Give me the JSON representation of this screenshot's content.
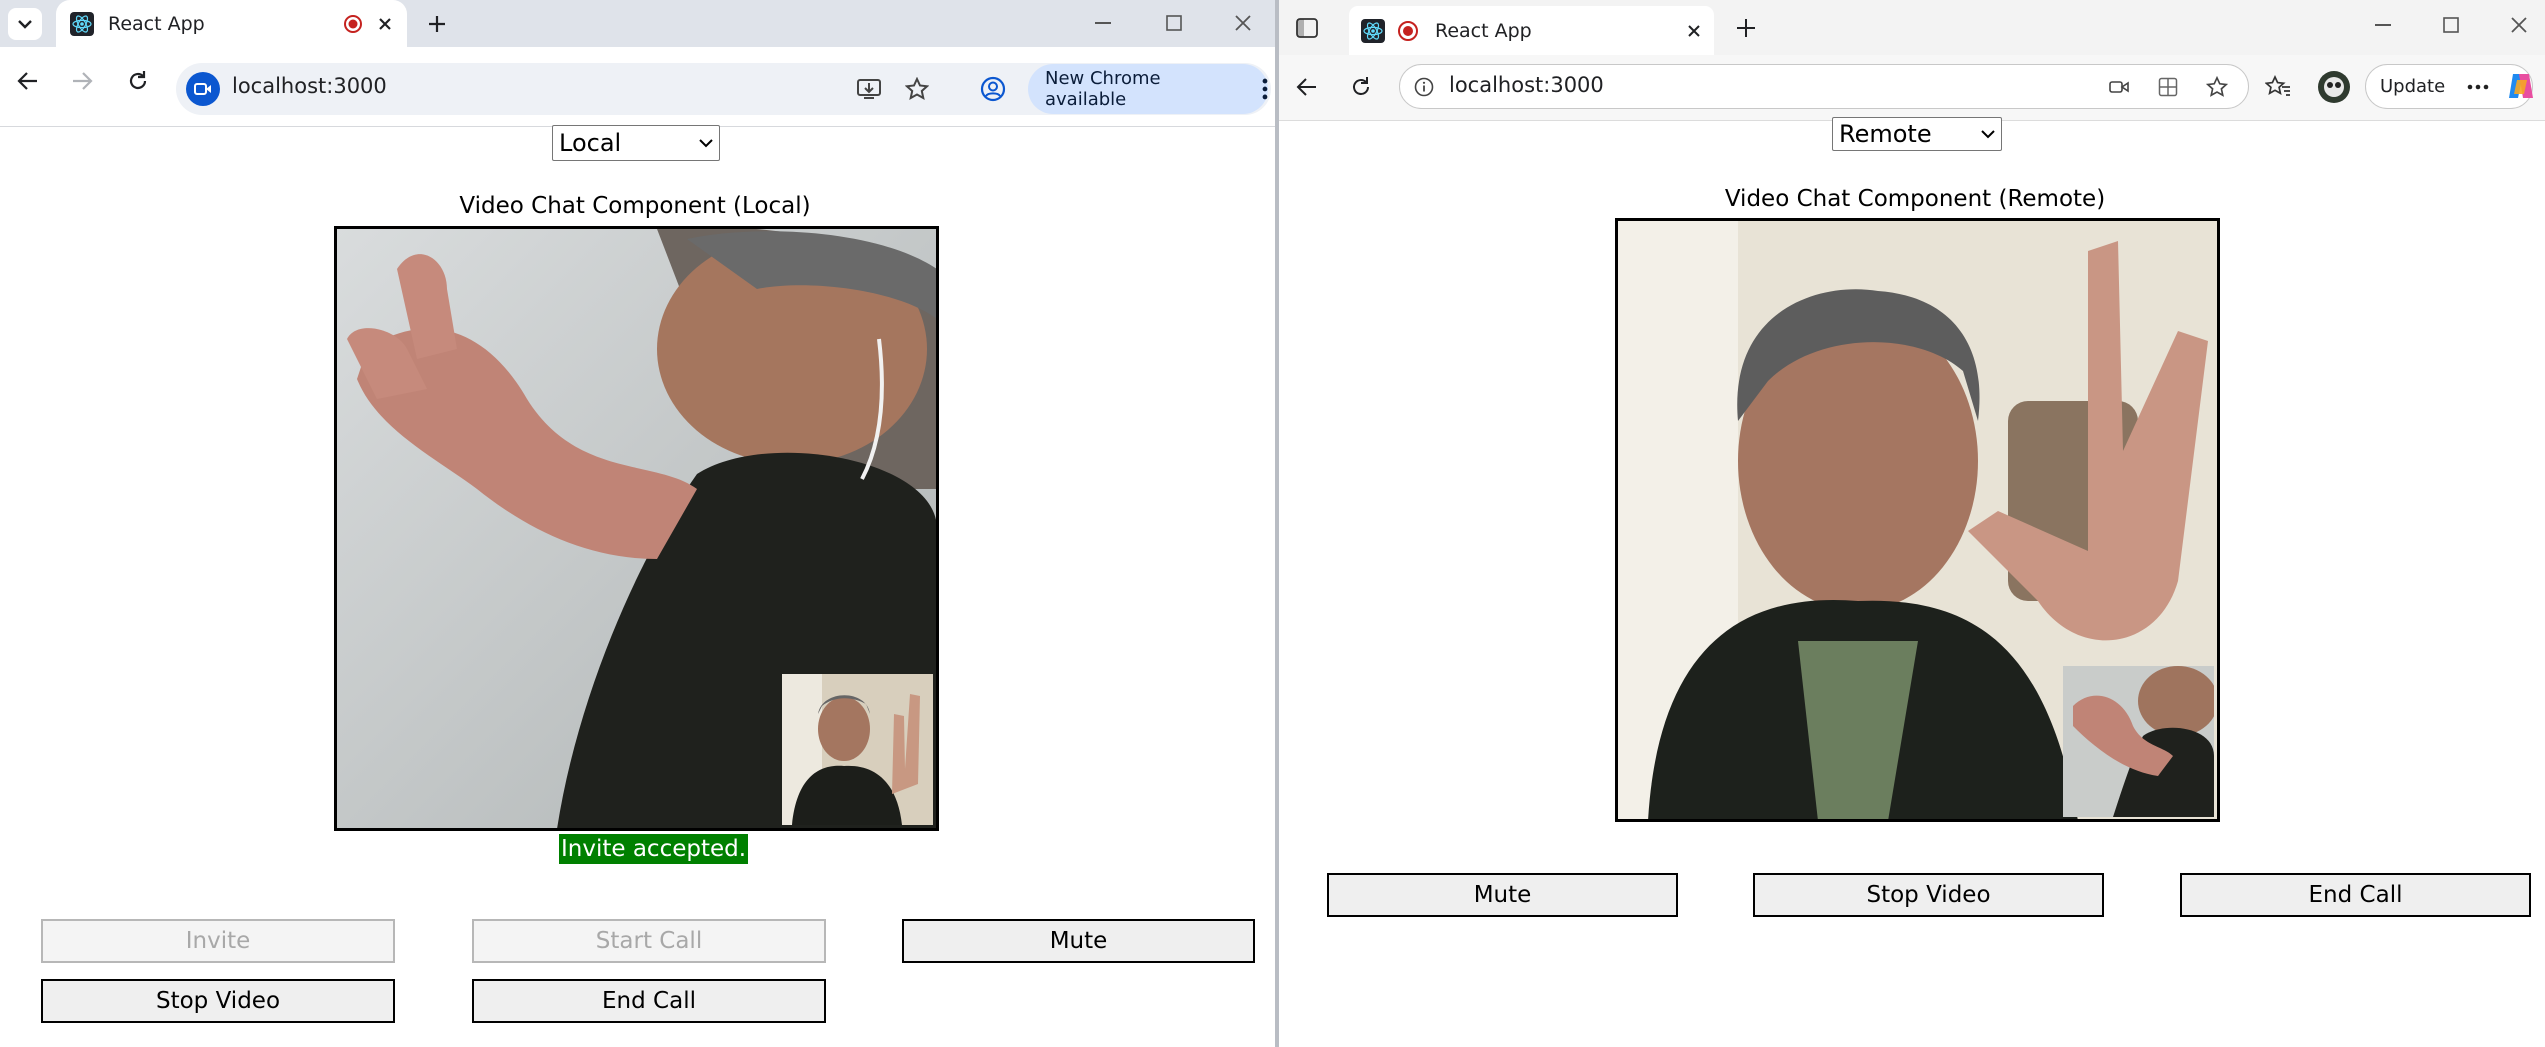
{
  "left_browser": {
    "tab_title": "React App",
    "address": "localhost:3000",
    "update_chip": "New Chrome available",
    "page": {
      "select_value": "Local",
      "heading": "Video Chat Component (Local)",
      "status": "Invite accepted.",
      "buttons": {
        "invite": "Invite",
        "start_call": "Start Call",
        "mute": "Mute",
        "stop_video": "Stop Video",
        "end_call": "End Call"
      }
    }
  },
  "right_browser": {
    "tab_title": "React App",
    "address": "localhost:3000",
    "update_button": "Update",
    "page": {
      "select_value": "Remote",
      "heading": "Video Chat Component (Remote)",
      "buttons": {
        "mute": "Mute",
        "stop_video": "Stop Video",
        "end_call": "End Call"
      }
    }
  },
  "colors": {
    "status_bg": "#008000",
    "chrome_tabstrip": "#dfe3ea",
    "chrome_update_chip": "#d3e3fd"
  }
}
